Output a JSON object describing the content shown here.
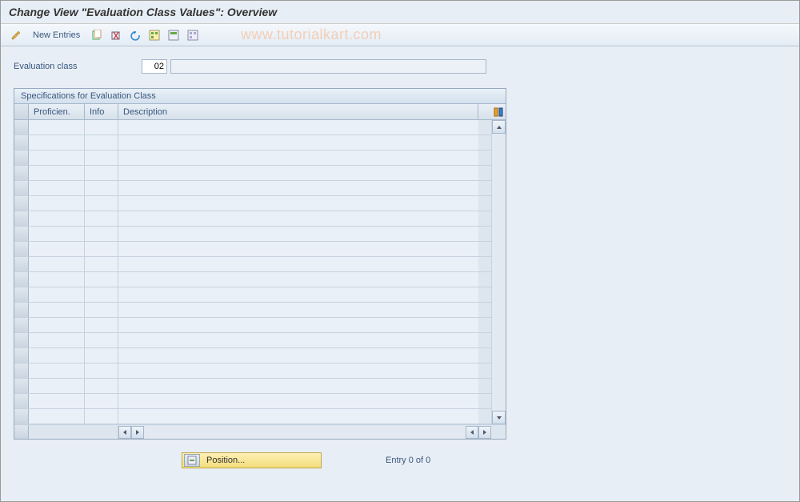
{
  "title": "Change View \"Evaluation Class Values\": Overview",
  "toolbar": {
    "new_entries_label": "New Entries"
  },
  "watermark": "www.tutorialkart.com",
  "form": {
    "eval_class_label": "Evaluation class",
    "eval_class_value": "02",
    "eval_class_desc": ""
  },
  "panel": {
    "title": "Specifications for Evaluation Class",
    "columns": {
      "proficiency": "Proficien.",
      "info": "Info",
      "description": "Description"
    },
    "row_count": 20
  },
  "footer": {
    "position_label": "Position...",
    "entry_text": "Entry 0 of 0"
  }
}
